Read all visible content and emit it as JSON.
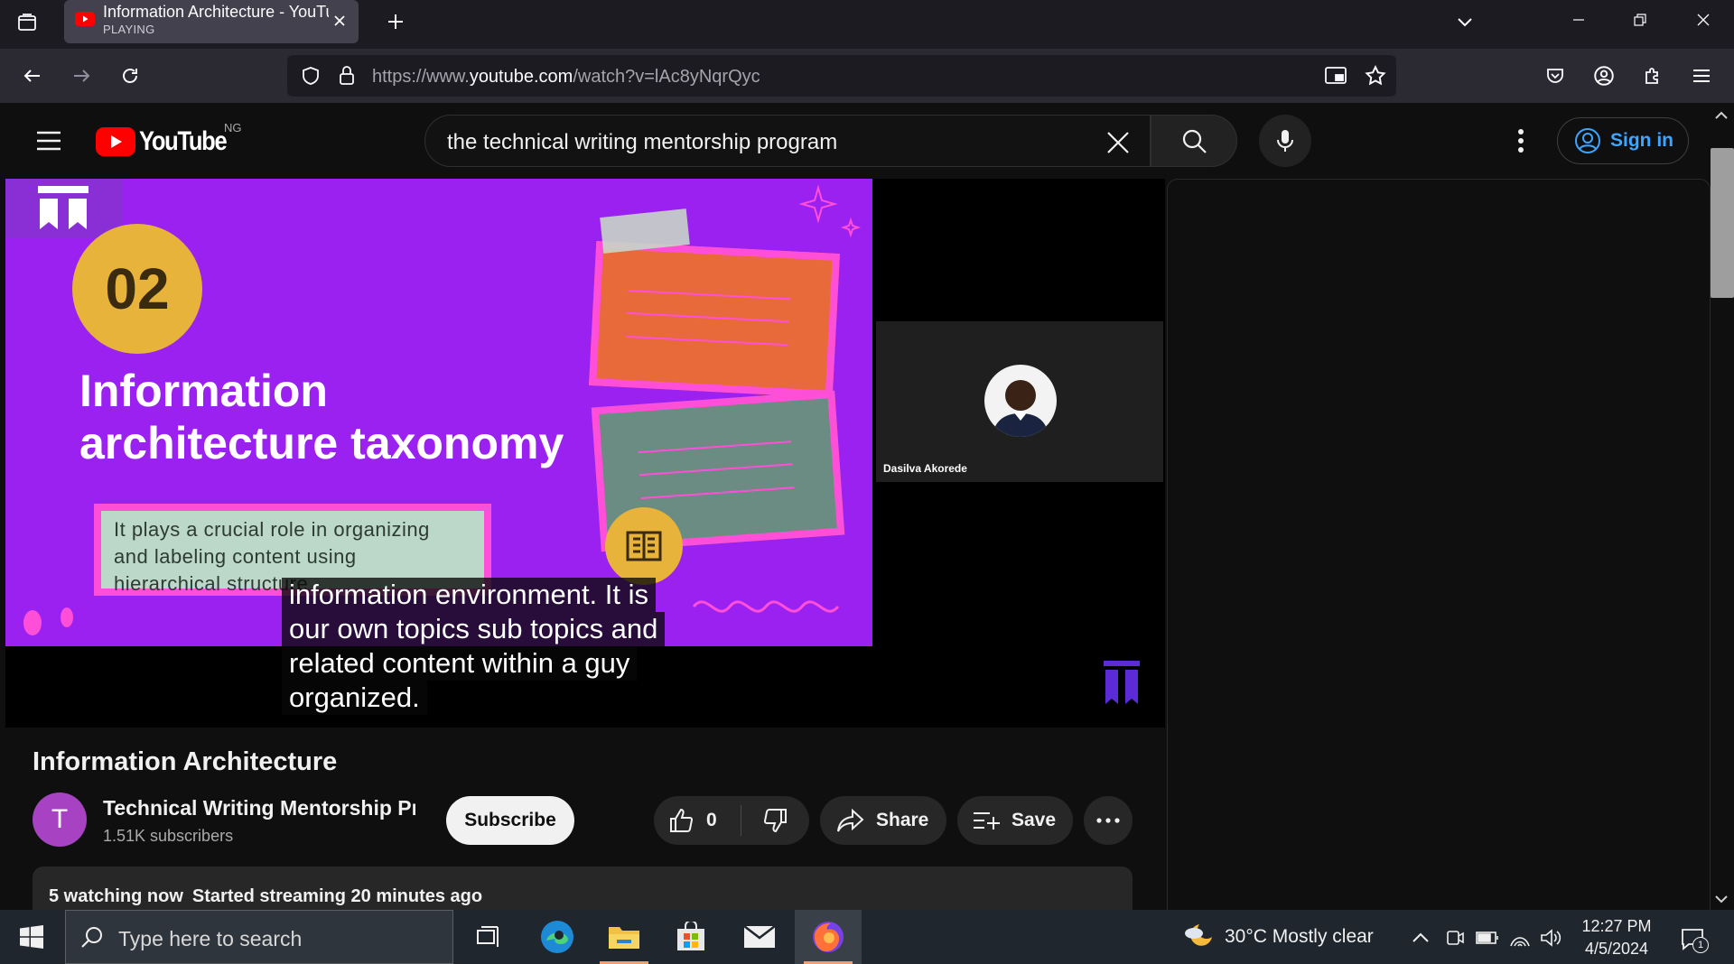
{
  "browser": {
    "tab": {
      "title": "Information Architecture - YouTube",
      "status": "PLAYING"
    },
    "url": {
      "prefix": "https://www.",
      "domain": "youtube.com",
      "path": "/watch?v=lAc8yNqrQyc"
    }
  },
  "youtube": {
    "logo_text": "YouTube",
    "country_code": "NG",
    "search_value": "the technical writing mentorship program",
    "sign_in_label": "Sign in"
  },
  "video": {
    "slide": {
      "number": "02",
      "title_line1": "Information",
      "title_line2": "architecture taxonomy",
      "box_lines": [
        "It plays a crucial role in organizing",
        "and labeling content using",
        "hierarchical structure"
      ]
    },
    "participant_name": "Dasilva Akorede",
    "captions": [
      "information environment. It is",
      "our own topics sub topics and",
      "related content within a guy",
      "organized."
    ]
  },
  "watch": {
    "title": "Information Architecture",
    "channel": {
      "avatar_letter": "T",
      "name": "Technical Writing Mentorship Program",
      "subscribers": "1.51K subscribers"
    },
    "subscribe_label": "Subscribe",
    "like_count": "0",
    "share_label": "Share",
    "save_label": "Save",
    "description": {
      "watching": "5 watching now",
      "started": "Started streaming 20 minutes ago"
    }
  },
  "taskbar": {
    "search_placeholder": "Type here to search",
    "weather": {
      "temp": "30°C",
      "condition": "Mostly clear"
    },
    "time": "12:27 PM",
    "date": "4/5/2024",
    "notification_count": "1"
  },
  "colors": {
    "youtube_red": "#ff0000",
    "link_blue": "#3ea6ff",
    "slide_purple": "#9a21f0",
    "accent_pink": "#ff4fd8",
    "accent_gold": "#e7b33a"
  }
}
